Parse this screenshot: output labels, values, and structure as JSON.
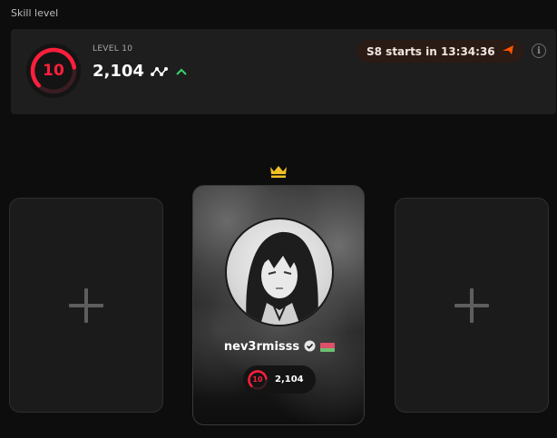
{
  "section": {
    "title": "Skill level"
  },
  "skill": {
    "level_label": "LEVEL 10",
    "level_number": "10",
    "elo": "2,104",
    "level_fill": 0.8,
    "trend_icon": "trend-wave-icon",
    "change_icon": "arrow-up-icon",
    "season_text": "S8 starts in 13:34:36",
    "season_icon": "faceit-arrow-icon",
    "info_icon": "info-icon"
  },
  "party": {
    "leader_icon": "crown-icon",
    "empty_slot_icon": "plus-icon",
    "player": {
      "nickname": "nev3rmisss",
      "verified_icon": "verified-badge-icon",
      "flag_icon": "belarus-flag-icon",
      "level_number": "10",
      "elo": "2,104"
    }
  },
  "colors": {
    "level_red": "#fe1f3c",
    "trend_green": "#3ad46d",
    "accent_orange": "#ff5500",
    "crown_gold": "#f2c025",
    "card_bg": "#1e1e1e"
  }
}
